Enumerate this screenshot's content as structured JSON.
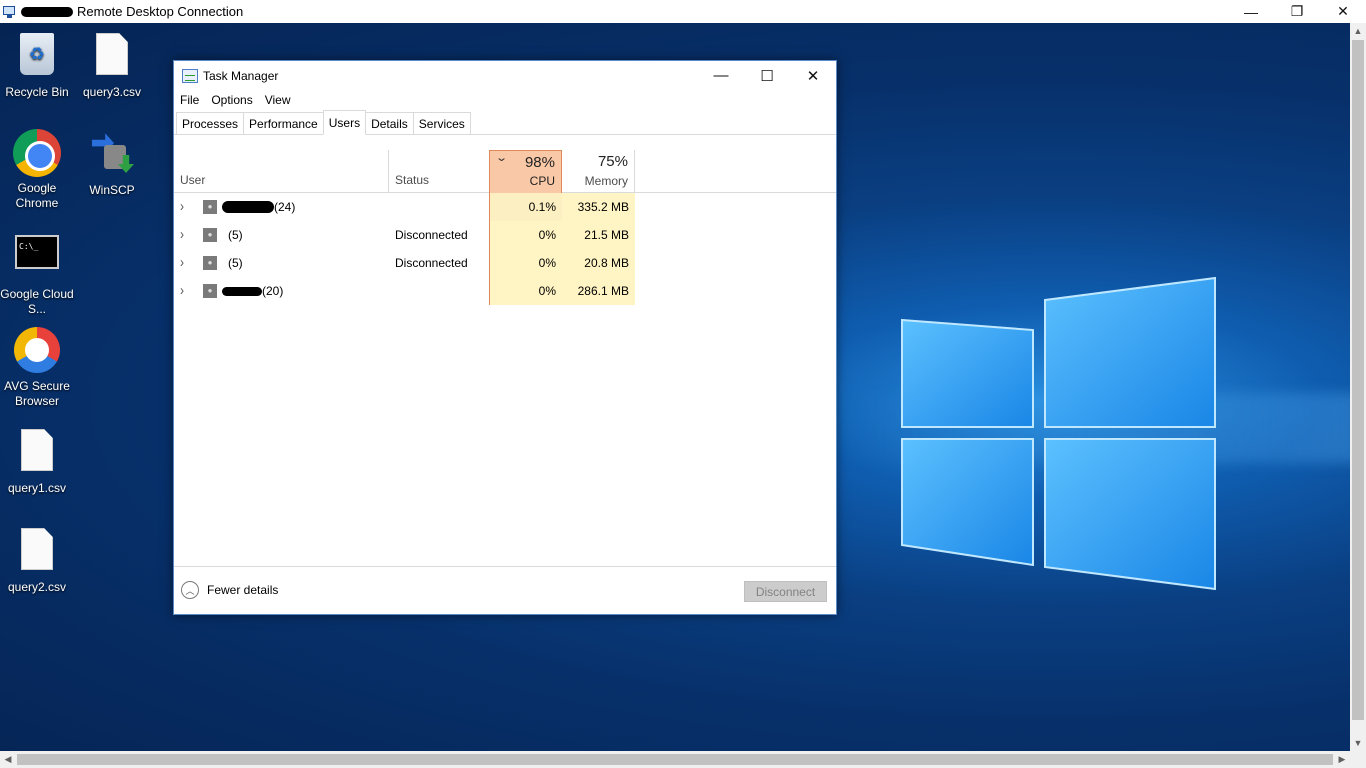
{
  "rdp": {
    "title": "Remote Desktop Connection",
    "minimize": "—",
    "restore": "❐",
    "close": "✕"
  },
  "desktop_icons": [
    {
      "label": "Recycle Bin",
      "icon": "recycle-bin-icon"
    },
    {
      "label": "query3.csv",
      "icon": "file-icon"
    },
    {
      "label": "Google Chrome",
      "icon": "chrome-icon"
    },
    {
      "label": "WinSCP",
      "icon": "winscp-icon"
    },
    {
      "label": "Google Cloud S...",
      "icon": "cloud-sdk-shell-icon"
    },
    {
      "label": "AVG Secure Browser",
      "icon": "avg-browser-icon"
    },
    {
      "label": "query1.csv",
      "icon": "file-icon"
    },
    {
      "label": "query2.csv",
      "icon": "file-icon"
    }
  ],
  "task_manager": {
    "title": "Task Manager",
    "menu": [
      "File",
      "Options",
      "View"
    ],
    "tabs": [
      "Processes",
      "Performance",
      "Users",
      "Details",
      "Services"
    ],
    "active_tab": "Users",
    "columns": {
      "user": "User",
      "status": "Status",
      "cpu_pct": "98%",
      "cpu_label": "CPU",
      "mem_pct": "75%",
      "mem_label": "Memory"
    },
    "rows": [
      {
        "user_suffix": "(24)",
        "status": "",
        "cpu": "0.1%",
        "memory": "335.2 MB"
      },
      {
        "user_suffix": "(5)",
        "status": "Disconnected",
        "cpu": "0%",
        "memory": "21.5 MB"
      },
      {
        "user_suffix": "(5)",
        "status": "Disconnected",
        "cpu": "0%",
        "memory": "20.8 MB"
      },
      {
        "user_suffix": "(20)",
        "status": "",
        "cpu": "0%",
        "memory": "286.1 MB"
      }
    ],
    "footer": {
      "fewer_details": "Fewer details",
      "disconnect": "Disconnect"
    }
  },
  "colors": {
    "cpu_header": "#f9c8a7",
    "cpu_cell": "#fcefc2",
    "mem_cell": "#fff4c4",
    "tm_border": "#5b8ac9"
  }
}
